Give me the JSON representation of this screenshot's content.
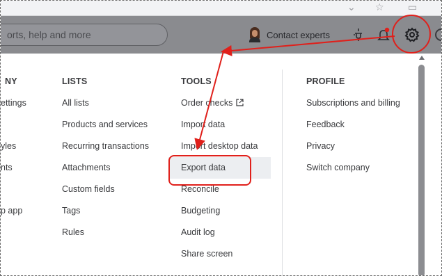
{
  "topbar": {
    "search_placeholder": "orts, help and more",
    "contact_label": "Contact experts"
  },
  "columns": {
    "company": {
      "heading": "NY",
      "items": [
        "ettings",
        "",
        "yles",
        "nts",
        "",
        "p app"
      ]
    },
    "lists": {
      "heading": "LISTS",
      "items": [
        "All lists",
        "Products and services",
        "Recurring transactions",
        "Attachments",
        "Custom fields",
        "Tags",
        "Rules"
      ]
    },
    "tools": {
      "heading": "TOOLS",
      "items": [
        "Order checks",
        "Import data",
        "Import desktop data",
        "Export data",
        "Reconcile",
        "Budgeting",
        "Audit log",
        "Share screen"
      ]
    },
    "profile": {
      "heading": "PROFILE",
      "items": [
        "Subscriptions and billing",
        "Feedback",
        "Privacy",
        "Switch company"
      ]
    }
  },
  "highlighted_item": "Export data",
  "icons": {
    "gear": "gear-icon",
    "plug": "plug-icon",
    "bell": "bell-icon",
    "help": "help-icon",
    "external": "external-link-icon"
  },
  "colors": {
    "annotation_red": "#e0201b",
    "topbar": "#8a8b8f",
    "highlight": "#eceef1"
  }
}
